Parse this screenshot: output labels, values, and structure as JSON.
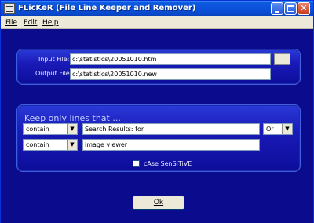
{
  "window": {
    "title": "FLicKeR (File Line Keeper and Remover)"
  },
  "menu": {
    "items": [
      {
        "label": "File"
      },
      {
        "label": "Edit"
      },
      {
        "label": "Help"
      }
    ]
  },
  "files": {
    "input_label": "Input File:",
    "input_value": "c:\\statistics\\20051010.htm",
    "output_label": "Output File:",
    "output_value": "c:\\statistics\\20051010.new",
    "browse_label": "..."
  },
  "filter": {
    "heading": "Keep only lines that ...",
    "rows": [
      {
        "condition": "contain",
        "text": "Search Results: for",
        "operator": "Or"
      },
      {
        "condition": "contain",
        "text": "image viewer"
      }
    ],
    "case_label": "cAse SenSiTiVE",
    "case_checked": false
  },
  "ok_label": "Ok",
  "colors": {
    "background": "#0a0a8a",
    "panel": "#1a1ab8",
    "titlebar": "#0a50d8"
  }
}
